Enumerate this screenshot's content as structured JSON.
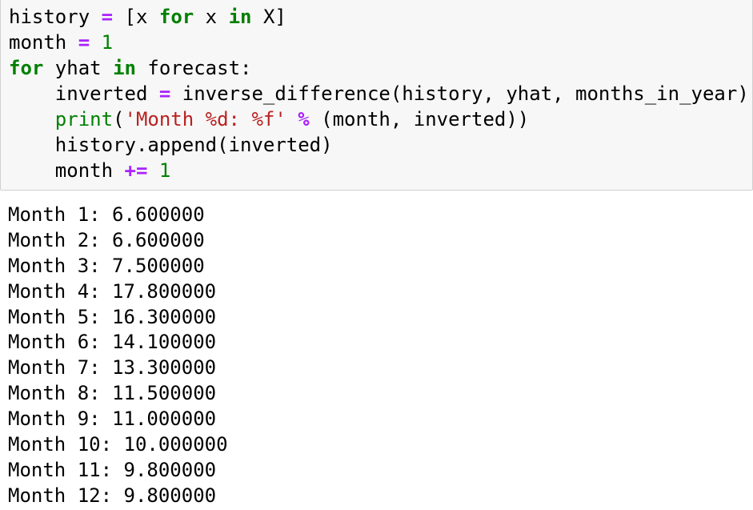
{
  "code": {
    "line1": {
      "var": "history",
      "op": "=",
      "rest_a": "[x ",
      "kw_for": "for",
      "rest_b": " x ",
      "kw_in": "in",
      "rest_c": " X]"
    },
    "line2": {
      "var": "month",
      "op": "=",
      "num": "1"
    },
    "line3": {
      "kw_for": "for",
      "mid": " yhat ",
      "kw_in": "in",
      "rest": " forecast:"
    },
    "line4": {
      "indent": "    ",
      "var": "inverted",
      "op": "=",
      "rest": "inverse_difference(history, yhat, months_in_year)"
    },
    "line5": {
      "indent": "    ",
      "builtin": "print",
      "paren": "(",
      "str": "'Month %d: %f'",
      "op": "%",
      "rest": "(month, inverted))"
    },
    "line6": {
      "indent": "    ",
      "text": "history.append(inverted)"
    },
    "line7": {
      "indent": "    ",
      "var": "month",
      "op": "+=",
      "num": "1"
    }
  },
  "output": [
    "Month 1: 6.600000",
    "Month 2: 6.600000",
    "Month 3: 7.500000",
    "Month 4: 17.800000",
    "Month 5: 16.300000",
    "Month 6: 14.100000",
    "Month 7: 13.300000",
    "Month 8: 11.500000",
    "Month 9: 11.000000",
    "Month 10: 10.000000",
    "Month 11: 9.800000",
    "Month 12: 9.800000"
  ],
  "colors": {
    "keyword": "#008000",
    "operator": "#aa22ff",
    "string": "#ba2121",
    "cell_background": "#f7f7f7",
    "cell_border": "#cfcfcf"
  }
}
